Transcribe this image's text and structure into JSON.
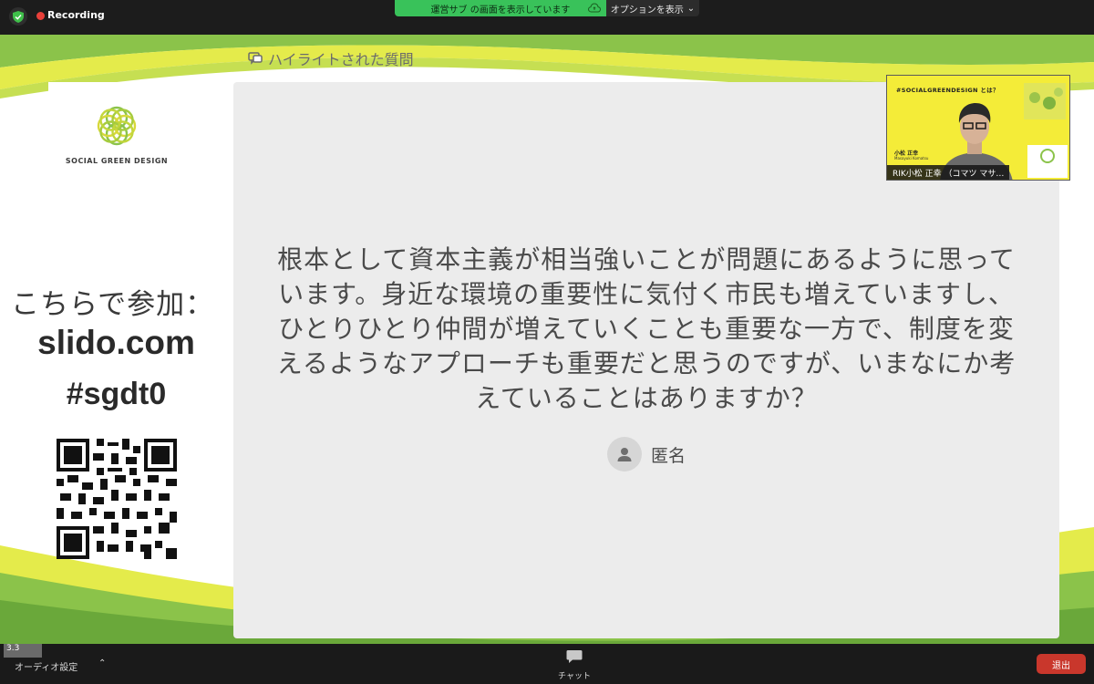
{
  "topbar": {
    "recording_label": "Recording",
    "share_status": "運営サブ の画面を表示しています",
    "options_label": "オプションを表示"
  },
  "slide": {
    "logo_text": "SOCIAL GREEN DESIGN",
    "join_label": "こちらで参加：",
    "join_url": "slido.com",
    "join_code": "#sgdt0",
    "highlight_header": "ハイライトされた質問",
    "question_text": "根本として資本主義が相当強いことが問題にあるように思っています。身近な環境の重要性に気付く市民も増えていますし、ひとりひとり仲間が増えていくことも重要な一方で、制度を変えるようなアプローチも重要だと思うのですが、いまなにか考えていることはありますか？",
    "author_name": "匿名"
  },
  "video_tile": {
    "slide_title": "#SOCIALGREENDESIGN とは？",
    "speaker_name_jp": "小松 正幸",
    "speaker_name_en": "Masayuki Komatsu",
    "participant_label": "RIK小松 正幸 （コマツ マサ…"
  },
  "bottombar": {
    "version_badge": "3.3",
    "audio_label": "オーディオ設定",
    "chat_label": "チャット",
    "leave_label": "退出"
  },
  "colors": {
    "accent_green": "#39c25a",
    "slide_green": "#8bc34a",
    "slide_yellow": "#e4eb4b",
    "leave_red": "#c9372c"
  }
}
